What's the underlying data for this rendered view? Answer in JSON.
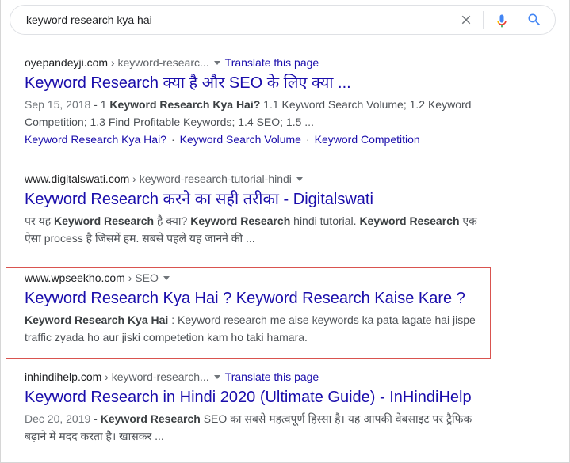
{
  "search": {
    "query": "keyword research kya hai"
  },
  "results": [
    {
      "domain": "oyepandeyji.com",
      "path": " › keyword-researc...",
      "translate": "Translate this page",
      "title": "Keyword Research क्या है और SEO के लिए क्या ...",
      "date": "Sep 15, 2018",
      "snippet_parts": [
        " - 1 ",
        "Keyword Research Kya Hai?",
        " 1.1 Keyword Search Volume; 1.2 Keyword Competition; 1.3 Find Profitable Keywords; 1.4 SEO; 1.5 ..."
      ],
      "sitelinks": [
        "Keyword Research Kya Hai?",
        "Keyword Search Volume",
        "Keyword Competition"
      ],
      "sitelink_separator": "·"
    },
    {
      "domain": "www.digitalswati.com",
      "path": " › keyword-research-tutorial-hindi",
      "title": "Keyword Research करने का सही तरीका - Digitalswati",
      "snippet_parts": [
        "पर यह ",
        "Keyword Research",
        " है क्या? ",
        "Keyword Research",
        " hindi tutorial. ",
        "Keyword Research",
        " एक ऐसा process है जिसमें हम. सबसे पहले यह जानने की ..."
      ]
    },
    {
      "domain": "www.wpseekho.com",
      "path": " › SEO",
      "title": "Keyword Research Kya Hai ? Keyword Research Kaise Kare ?",
      "snippet_parts": [
        "Keyword Research Kya Hai",
        " : Keyword research me aise keywords ka pata lagate hai jispe traffic zyada ho aur jiski competetion kam ho taki hamara."
      ]
    },
    {
      "domain": "inhindihelp.com",
      "path": " › keyword-research...",
      "translate": "Translate this page",
      "title": "Keyword Research in Hindi 2020 (Ultimate Guide) - InHindiHelp",
      "date": "Dec 20, 2019",
      "snippet_parts": [
        " - ",
        "Keyword Research",
        " SEO का सबसे महत्वपूर्ण हिस्सा है। यह आपकी वेबसाइट पर ट्रैफिक बढ़ाने में मदद करता है। खासकर ..."
      ]
    }
  ],
  "colors": {
    "link": "#1a0dab",
    "highlight_border": "#d9534f",
    "snippet": "#4d5156",
    "date": "#70757a"
  },
  "icons": [
    "clear-icon",
    "mic-icon",
    "search-icon",
    "caret-down-icon"
  ]
}
